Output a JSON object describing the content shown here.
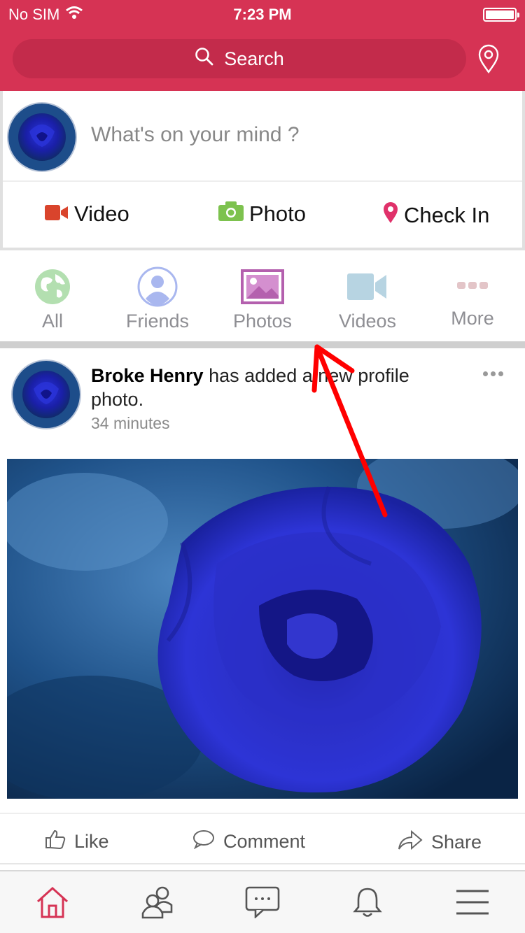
{
  "status_bar": {
    "carrier": "No SIM",
    "time": "7:23 PM"
  },
  "search": {
    "label": "Search"
  },
  "composer": {
    "placeholder": "What's on your mind ?",
    "actions": [
      {
        "label": "Video",
        "icon": "video-camera-icon",
        "color": "#d9442c"
      },
      {
        "label": "Photo",
        "icon": "camera-icon",
        "color": "#7dc24e"
      },
      {
        "label": "Check In",
        "icon": "map-pin-icon",
        "color": "#e0316a"
      }
    ]
  },
  "filters": [
    {
      "label": "All",
      "icon": "globe-icon"
    },
    {
      "label": "Friends",
      "icon": "person-icon"
    },
    {
      "label": "Photos",
      "icon": "image-icon"
    },
    {
      "label": "Videos",
      "icon": "video-icon"
    },
    {
      "label": "More",
      "icon": "more-dots-icon"
    }
  ],
  "post": {
    "author": "Broke Henry",
    "action_text": "has added a new profile photo.",
    "time": "34 minutes"
  },
  "reactions": {
    "like": "Like",
    "comment": "Comment",
    "share": "Share"
  },
  "tabs": [
    "home-icon",
    "friends-icon",
    "messages-icon",
    "notifications-icon",
    "menu-icon"
  ],
  "colors": {
    "brand": "#d63354",
    "search_bg": "#c32b4b",
    "annotation": "#ff0000"
  }
}
